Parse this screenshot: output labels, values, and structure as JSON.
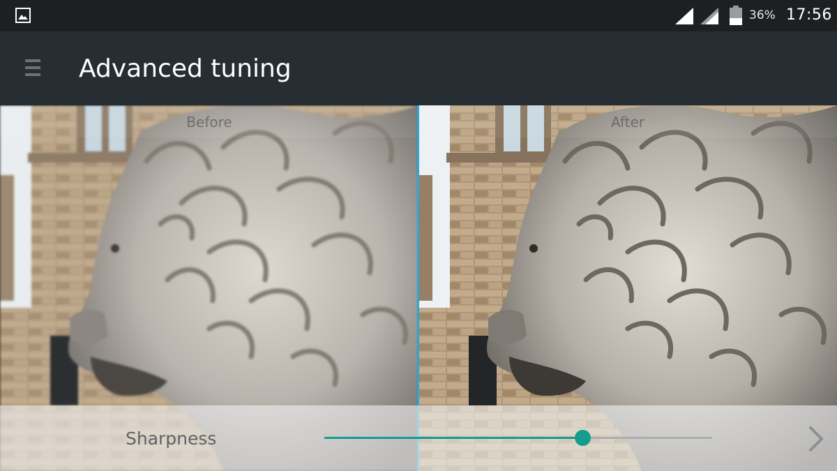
{
  "status_bar": {
    "battery_percent": "36%",
    "time": "17:56",
    "icons": [
      "gallery-icon",
      "signal-icon",
      "signal-icon",
      "battery-icon"
    ]
  },
  "app_bar": {
    "title": "Advanced tuning",
    "menu_icon": "menu-icon"
  },
  "compare": {
    "before_label": "Before",
    "after_label": "After"
  },
  "control": {
    "label": "Sharpness",
    "slider_value": 0.665,
    "next_icon": "chevron-right-icon"
  },
  "colors": {
    "status_bar_bg": "#1c2023",
    "app_bar_bg": "#262e34",
    "accent": "#149c8c",
    "divider": "#2aa8d8"
  }
}
